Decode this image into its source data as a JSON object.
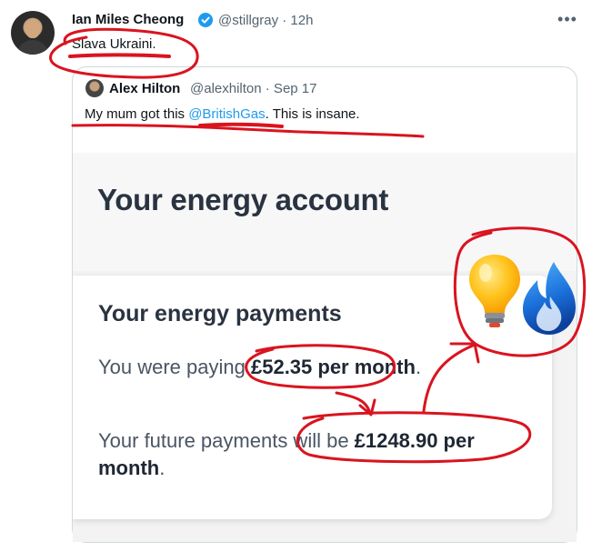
{
  "tweet": {
    "author_name": "Ian Miles Cheong",
    "author_meta": "@stillgray · 12h",
    "text": "Slava Ukraini.",
    "more_icon": "more-horizontal-icon",
    "verified_icon": "verified-badge-icon"
  },
  "quote": {
    "author_name": "Alex Hilton",
    "author_meta": "@alexhilton · Sep 17",
    "text_before": "My mum got this ",
    "mention": "@BritishGas",
    "text_after": ". This is insane."
  },
  "embed": {
    "title": "Your energy account",
    "payments_heading": "Your energy payments",
    "paying_prefix": "You were paying ",
    "paying_amount": "£52.35 per month",
    "paying_suffix": ".",
    "future_prefix": "Your future payments will be ",
    "future_amount": "£1248.90 per month",
    "future_suffix": ".",
    "icons": [
      "lightbulb-icon",
      "gas-flame-icon"
    ]
  },
  "colors": {
    "link": "#1d9bf0",
    "annotation": "#d9141f",
    "muted": "#536471"
  }
}
